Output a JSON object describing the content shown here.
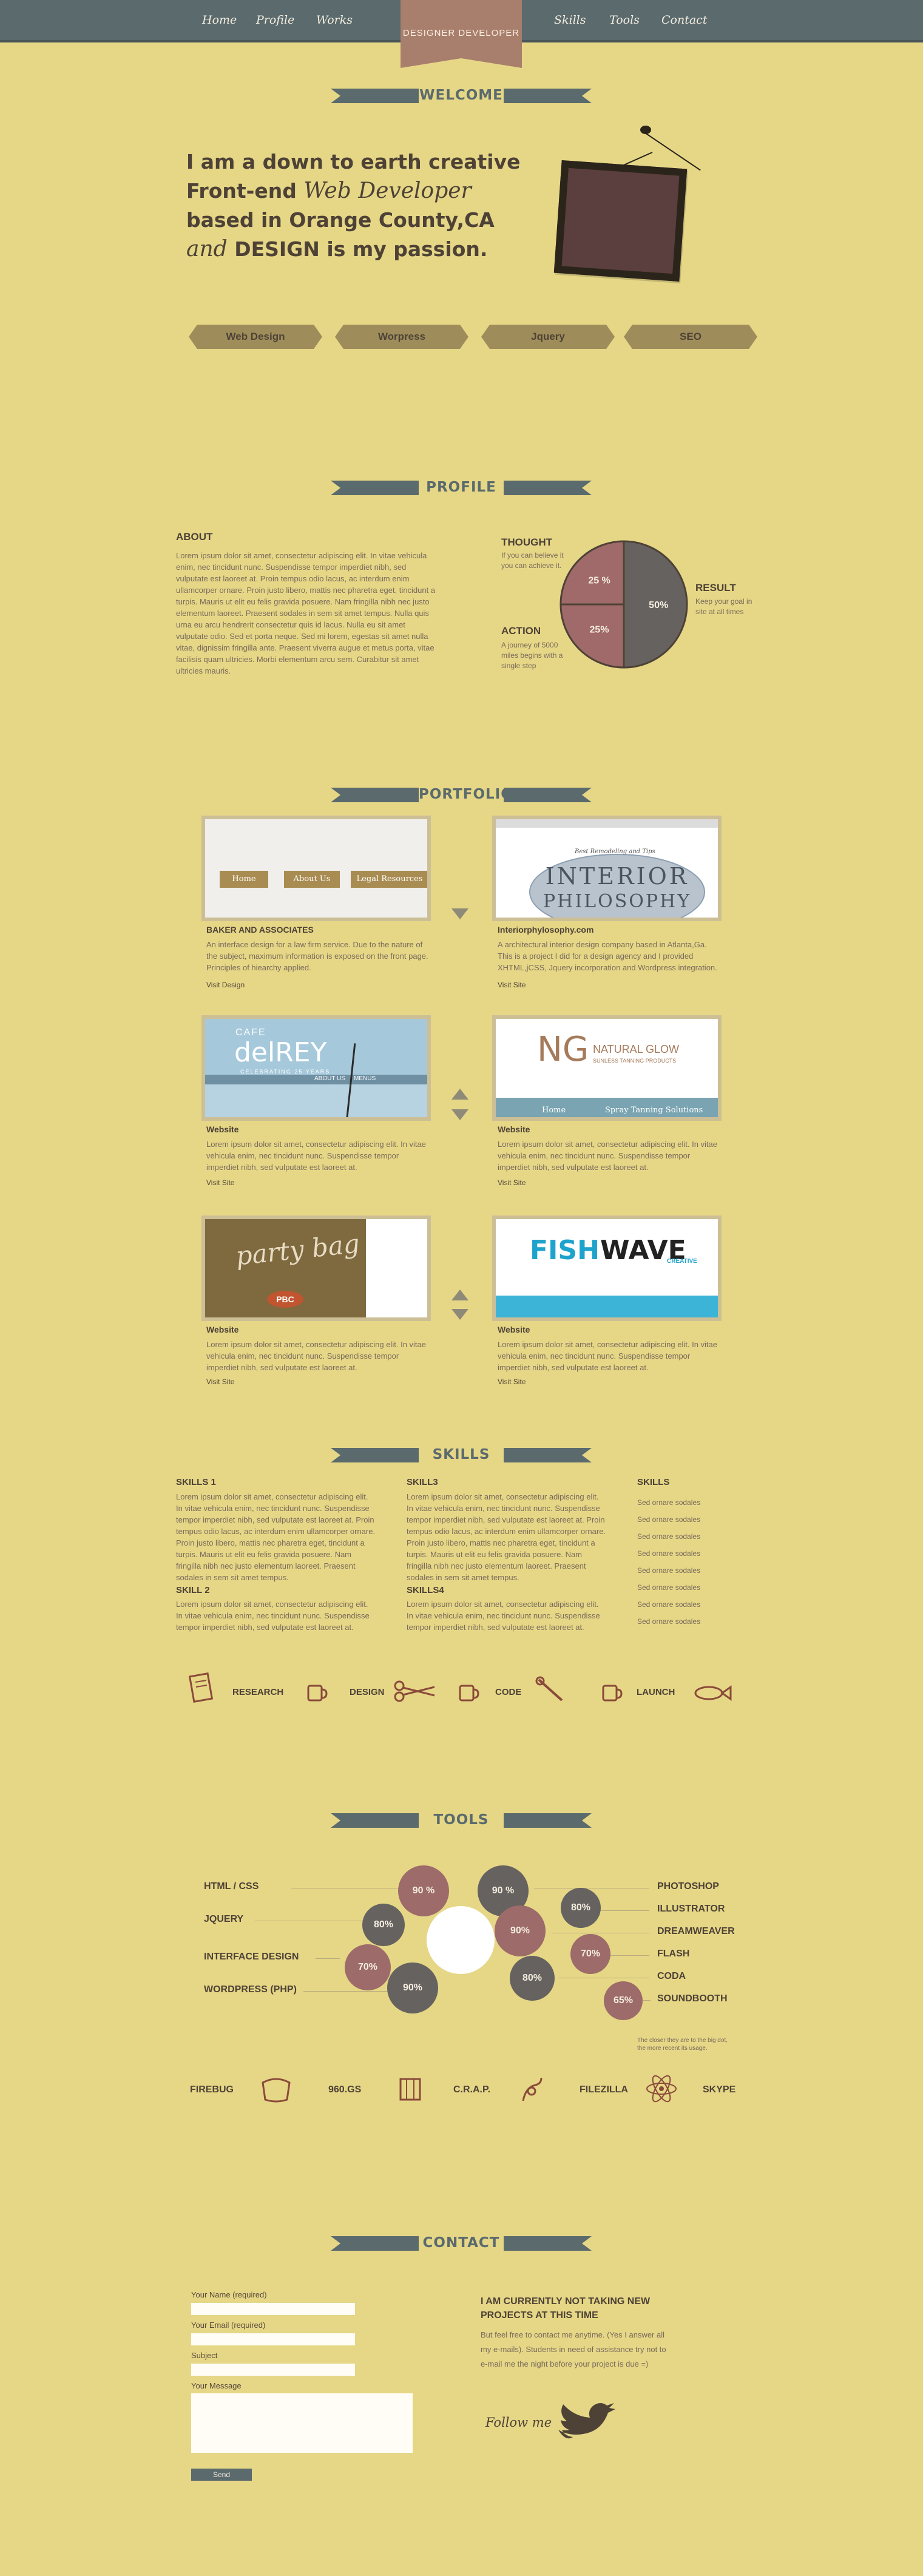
{
  "nav": {
    "left": [
      "Home",
      "Profile",
      "Works"
    ],
    "right": [
      "Skills",
      "Tools",
      "Contact"
    ],
    "brand": "DESIGNER DEVELOPER"
  },
  "sections": {
    "welcome": "WELCOME",
    "profile": "PROFILE",
    "portfolio": "PORTFOLIO",
    "skills": "SKILLS",
    "tools": "TOOLS",
    "contact": "CONTACT"
  },
  "intro": {
    "line1": "I am a down to earth creative",
    "line2a": "Front-end",
    "line2b": "Web Developer",
    "line3": "based in Orange County,CA",
    "line4a": "and",
    "line4b": "DESIGN is my passion."
  },
  "tags": [
    "Web Design",
    "Worpress",
    "Jquery",
    "SEO"
  ],
  "about": {
    "heading": "ABOUT",
    "text": "Lorem ipsum dolor sit amet, consectetur adipiscing elit. In vitae vehicula enim, nec tincidunt nunc. Suspendisse tempor imperdiet nibh, sed vulputate est laoreet at. Proin tempus odio lacus, ac interdum enim ullamcorper ornare. Proin justo libero, mattis nec pharetra eget, tincidunt a turpis. Mauris ut elit eu felis gravida posuere. Nam fringilla nibh nec justo elementum laoreet. Praesent sodales in sem sit amet tempus. Nulla quis urna eu arcu hendrerit consectetur quis id lacus. Nulla eu sit amet vulputate odio. Sed et porta neque. Sed mi lorem, egestas sit amet nulla vitae, dignissim fringilla ante. Praesent viverra augue et metus porta, vitae facilisis quam ultricies. Morbi elementum arcu sem. Curabitur sit amet ultricies mauris."
  },
  "pie": {
    "thought": {
      "title": "THOUGHT",
      "text": "If you can believe it you can achieve it."
    },
    "action": {
      "title": "ACTION",
      "text": "A journey of 5000 miles begins with a single step"
    },
    "result": {
      "title": "RESULT",
      "text": "Keep your goal in site at all times"
    },
    "labels": [
      "25 %",
      "25%",
      "50%"
    ]
  },
  "chart_data": {
    "type": "pie",
    "categories": [
      "THOUGHT",
      "ACTION",
      "RESULT"
    ],
    "values": [
      25,
      25,
      50
    ],
    "colors": [
      "#a06a6a",
      "#a06a6a",
      "#66625f"
    ]
  },
  "portfolio": [
    {
      "title": "BAKER AND ASSOCIATES",
      "text": "An interface design for a law firm service. Due to the nature of the subject, maximum information is exposed on the front page. Principles of hiearchy applied.",
      "link": "Visit Design",
      "thumb": [
        "Home",
        "About Us",
        "Legal Resources"
      ]
    },
    {
      "title": "Interiorphylosophy.com",
      "text": "A architectural interior design company based in Atlanta,Ga. This is a project I did for a design agency and I provided XHTML,jCSS, Jquery incorporation and Wordpress integration.",
      "link": "Visit Site",
      "thumb": [
        "Best Remodeling and Tips",
        "INTERIOR",
        "PHILOSOPHY"
      ]
    },
    {
      "title": "Website",
      "text": "Lorem ipsum dolor sit amet, consectetur adipiscing elit. In vitae vehicula enim, nec tincidunt nunc. Suspendisse tempor imperdiet nibh, sed vulputate est laoreet at.",
      "link": "Visit Site",
      "thumb": [
        "CAFE",
        "delREY",
        "CELEBRATING 25 YEARS",
        "ABOUT US",
        "MENUS"
      ]
    },
    {
      "title": "Website",
      "text": "Lorem ipsum dolor sit amet, consectetur adipiscing elit. In vitae vehicula enim, nec tincidunt nunc. Suspendisse tempor imperdiet nibh, sed vulputate est laoreet at.",
      "link": "Visit Site",
      "thumb": [
        "NG",
        "NATURAL GLOW",
        "SUNLESS TANNING PRODUCTS",
        "Home",
        "Spray Tanning Solutions"
      ]
    },
    {
      "title": "Website",
      "text": "Lorem ipsum dolor sit amet, consectetur adipiscing elit. In vitae vehicula enim, nec tincidunt nunc. Suspendisse tempor imperdiet nibh, sed vulputate est laoreet at.",
      "link": "Visit Site",
      "thumb": [
        "party bag",
        "PBC"
      ]
    },
    {
      "title": "Website",
      "text": "Lorem ipsum dolor sit amet, consectetur adipiscing elit. In vitae vehicula enim, nec tincidunt nunc. Suspendisse tempor imperdiet nibh, sed vulputate est laoreet at.",
      "link": "Visit Site",
      "thumb": [
        "FISH",
        "WAVE",
        "CREATIVE"
      ]
    }
  ],
  "skills": {
    "col1": [
      {
        "title": "SKILLS 1",
        "text": "Lorem ipsum dolor sit amet, consectetur adipiscing elit. In vitae vehicula enim, nec tincidunt nunc. Suspendisse tempor imperdiet nibh, sed vulputate est laoreet at. Proin tempus odio lacus, ac interdum enim ullamcorper ornare. Proin justo libero, mattis nec pharetra eget, tincidunt a turpis. Mauris ut elit eu felis gravida posuere. Nam fringilla nibh nec justo elementum laoreet. Praesent sodales in sem sit amet tempus."
      },
      {
        "title": "SKILL 2",
        "text": "Lorem ipsum dolor sit amet, consectetur adipiscing elit. In vitae vehicula enim, nec tincidunt nunc. Suspendisse tempor imperdiet nibh, sed vulputate est laoreet at."
      }
    ],
    "col2": [
      {
        "title": "SKILL3",
        "text": "Lorem ipsum dolor sit amet, consectetur adipiscing elit. In vitae vehicula enim, nec tincidunt nunc. Suspendisse tempor imperdiet nibh, sed vulputate est laoreet at. Proin tempus odio lacus, ac interdum enim ullamcorper ornare. Proin justo libero, mattis nec pharetra eget, tincidunt a turpis. Mauris ut elit eu felis gravida posuere. Nam fringilla nibh nec justo elementum laoreet. Praesent sodales in sem sit amet tempus."
      },
      {
        "title": "SKILLS4",
        "text": "Lorem ipsum dolor sit amet, consectetur adipiscing elit. In vitae vehicula enim, nec tincidunt nunc. Suspendisse tempor imperdiet nibh, sed vulputate est laoreet at."
      }
    ],
    "col3": {
      "title": "SKILLS",
      "items": [
        "Sed ornare sodales",
        "Sed ornare sodales",
        "Sed ornare sodales",
        "Sed ornare sodales",
        "Sed ornare sodales",
        "Sed ornare sodales",
        "Sed ornare sodales",
        "Sed ornare sodales"
      ]
    }
  },
  "process": [
    "RESEARCH",
    "DESIGN",
    "CODE",
    "LAUNCH"
  ],
  "tools": {
    "left": [
      "HTML / CSS",
      "JQUERY",
      "INTERFACE DESIGN",
      "WORDPRESS (PHP)"
    ],
    "right": [
      "PHOTOSHOP",
      "ILLUSTRATOR",
      "DREAMWEAVER",
      "FLASH",
      "CODA",
      "SOUNDBOOTH"
    ],
    "bubbles": [
      "90 %",
      "80%",
      "70%",
      "90%",
      "90 %",
      "90%",
      "80%",
      "80%",
      "70%",
      "65%"
    ],
    "note": "The closer they are to the big dot, the more recent its usage."
  },
  "bottom_tools": [
    "FIREBUG",
    "960.GS",
    "C.R.A.P.",
    "FILEZILLA",
    "SKYPE"
  ],
  "contact": {
    "name_label": "Your Name (required)",
    "email_label": "Your Email (required)",
    "subject_label": "Subject",
    "message_label": "Your Message",
    "send": "Send",
    "heading": "I AM CURRENTLY NOT TAKING NEW PROJECTS AT THIS TIME",
    "text": "But feel free to contact me anytime. (Yes I answer all my e-mails). Students in need of assistance try not to e-mail me the night before your project is due =)",
    "follow": "Follow me"
  },
  "colors": {
    "bg": "#e6d787",
    "slate": "#5a6a6d",
    "rose": "#a06a6a",
    "dark": "#4e4236"
  }
}
